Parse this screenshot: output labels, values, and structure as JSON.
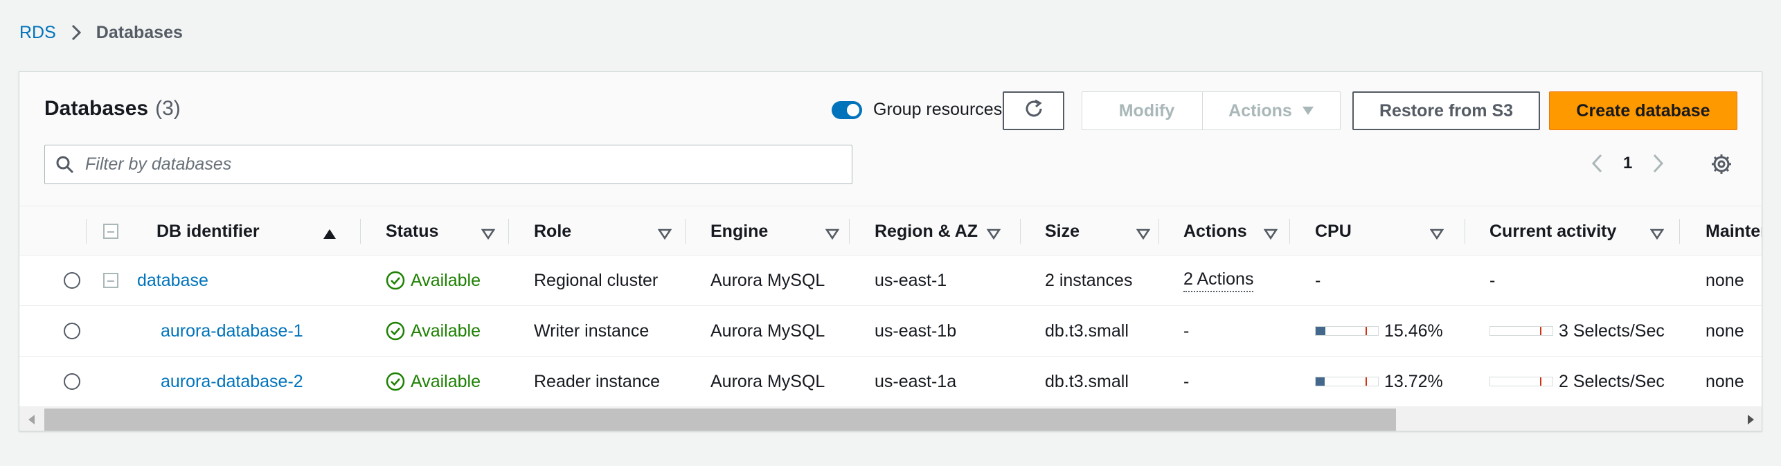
{
  "breadcrumb": {
    "root": "RDS",
    "current": "Databases"
  },
  "panel": {
    "title": "Databases",
    "count": "(3)"
  },
  "toolbar": {
    "group_resources_label": "Group resources",
    "group_resources_on": true,
    "modify_label": "Modify",
    "actions_label": "Actions",
    "restore_label": "Restore from S3",
    "create_label": "Create database"
  },
  "filter": {
    "placeholder": "Filter by databases",
    "value": ""
  },
  "pagination": {
    "current_page": "1"
  },
  "table": {
    "columns": {
      "db_identifier": "DB identifier",
      "status": "Status",
      "role": "Role",
      "engine": "Engine",
      "region_az": "Region & AZ",
      "size": "Size",
      "actions": "Actions",
      "cpu": "CPU",
      "current_activity": "Current activity",
      "maintenance": "Maintena"
    },
    "rows": [
      {
        "identifier": "database",
        "status": "Available",
        "role": "Regional cluster",
        "engine": "Aurora MySQL",
        "region_az": "us-east-1",
        "size": "2 instances",
        "actions": "2 Actions",
        "cpu": "-",
        "current_activity": "-",
        "maintenance": "none"
      },
      {
        "identifier": "aurora-database-1",
        "status": "Available",
        "role": "Writer instance",
        "engine": "Aurora MySQL",
        "region_az": "us-east-1b",
        "size": "db.t3.small",
        "actions": "-",
        "cpu": "15.46%",
        "cpu_fraction": 0.1546,
        "current_activity": "3 Selects/Sec",
        "maintenance": "none"
      },
      {
        "identifier": "aurora-database-2",
        "status": "Available",
        "role": "Reader instance",
        "engine": "Aurora MySQL",
        "region_az": "us-east-1a",
        "size": "db.t3.small",
        "actions": "-",
        "cpu": "13.72%",
        "cpu_fraction": 0.1372,
        "current_activity": "2 Selects/Sec",
        "maintenance": "none"
      }
    ]
  },
  "colors": {
    "link": "#0073bb",
    "available": "#1d8102",
    "primary_button": "#ff9900",
    "meter_fill": "#44688c",
    "meter_marker": "#d13212"
  }
}
